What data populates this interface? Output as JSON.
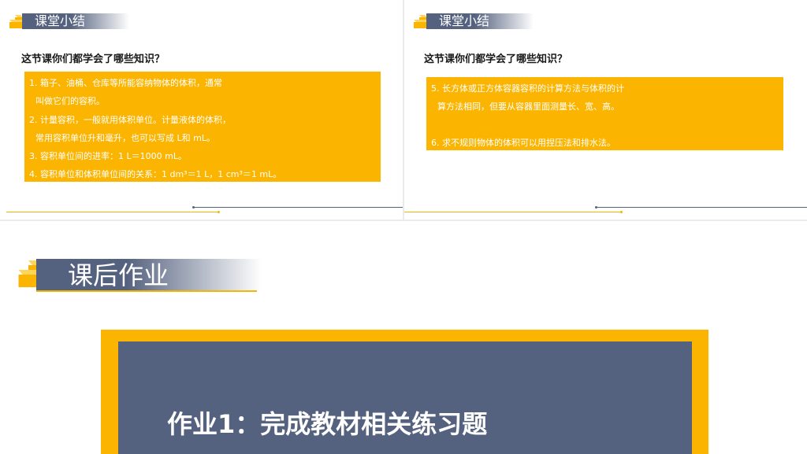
{
  "colors": {
    "accent": "#fbb400",
    "slate": "#55627f",
    "white": "#ffffff"
  },
  "slide_left": {
    "header": "课堂小结",
    "question": "这节课你们都学会了哪些知识？",
    "lines": [
      "1. 箱子、油桶、仓库等所能容纳物体的体积，通常",
      "叫做它们的容积。",
      "2. 计量容积，一般就用体积单位。计量液体的体积，",
      "常用容积单位升和毫升，也可以写成 L和 mL。",
      "3. 容积单位间的进率：1 L＝1000 mL。",
      "4. 容积单位和体积单位间的关系：1 dm³＝1 L，1 cm³＝1 mL。"
    ]
  },
  "slide_right": {
    "header": "课堂小结",
    "question": "这节课你们都学会了哪些知识？",
    "lines": [
      "5. 长方体或正方体容器容积的计算方法与体积的计",
      "算方法相同，但要从容器里面测量长、宽、高。",
      "",
      "6. 求不规则物体的体积可以用捏压法和排水法。"
    ]
  },
  "slide_bottom": {
    "title": "课后作业",
    "homework": "作业1：完成教材相关练习题"
  }
}
